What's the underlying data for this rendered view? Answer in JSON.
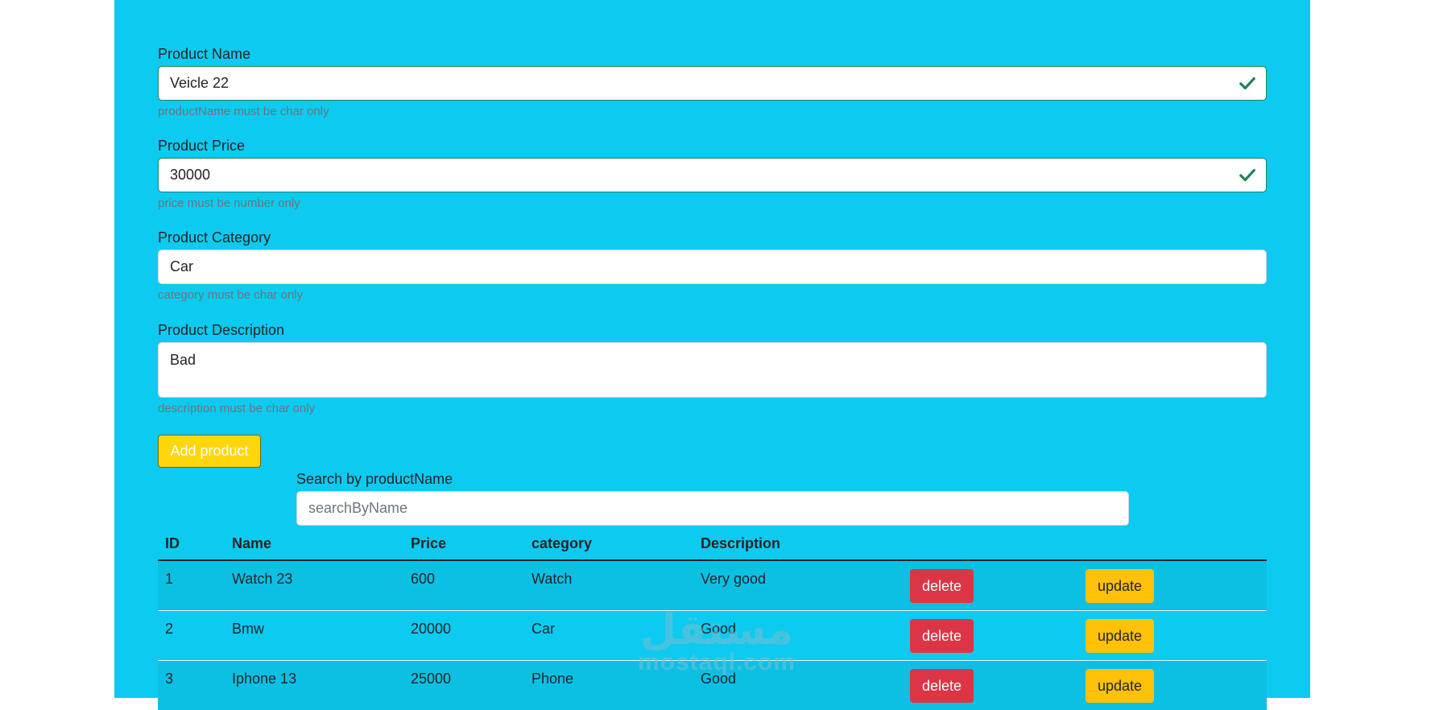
{
  "form": {
    "name": {
      "label": "Product Name",
      "value": "Veicle 22",
      "hint": "productName must be char only"
    },
    "price": {
      "label": "Product Price",
      "value": "30000",
      "hint": "price must be number only"
    },
    "category": {
      "label": "Product Category",
      "value": "Car",
      "hint": "category must be char only"
    },
    "description": {
      "label": "Product Description",
      "value": "Bad",
      "hint": "description must be char only"
    },
    "add_label": "Add product"
  },
  "search": {
    "label": "Search by productName",
    "placeholder": "searchByName"
  },
  "table": {
    "headers": [
      "ID",
      "Name",
      "Price",
      "category",
      "Description"
    ],
    "rows": [
      {
        "id": "1",
        "name": "Watch 23",
        "price": "600",
        "category": "Watch",
        "description": "Very good",
        "delete": "delete",
        "update": "update"
      },
      {
        "id": "2",
        "name": "Bmw",
        "price": "20000",
        "category": "Car",
        "description": "Good",
        "delete": "delete",
        "update": "update"
      },
      {
        "id": "3",
        "name": "Iphone 13",
        "price": "25000",
        "category": "Phone",
        "description": "Good",
        "delete": "delete",
        "update": "update"
      }
    ]
  },
  "watermark": {
    "arabic": "مستقل",
    "latin": "mostaql.com"
  },
  "colors": {
    "panel": "#0dcaf0",
    "danger": "#dc3545",
    "warning": "#ffc107",
    "success": "#198754",
    "add_button": "#ffd60a"
  }
}
